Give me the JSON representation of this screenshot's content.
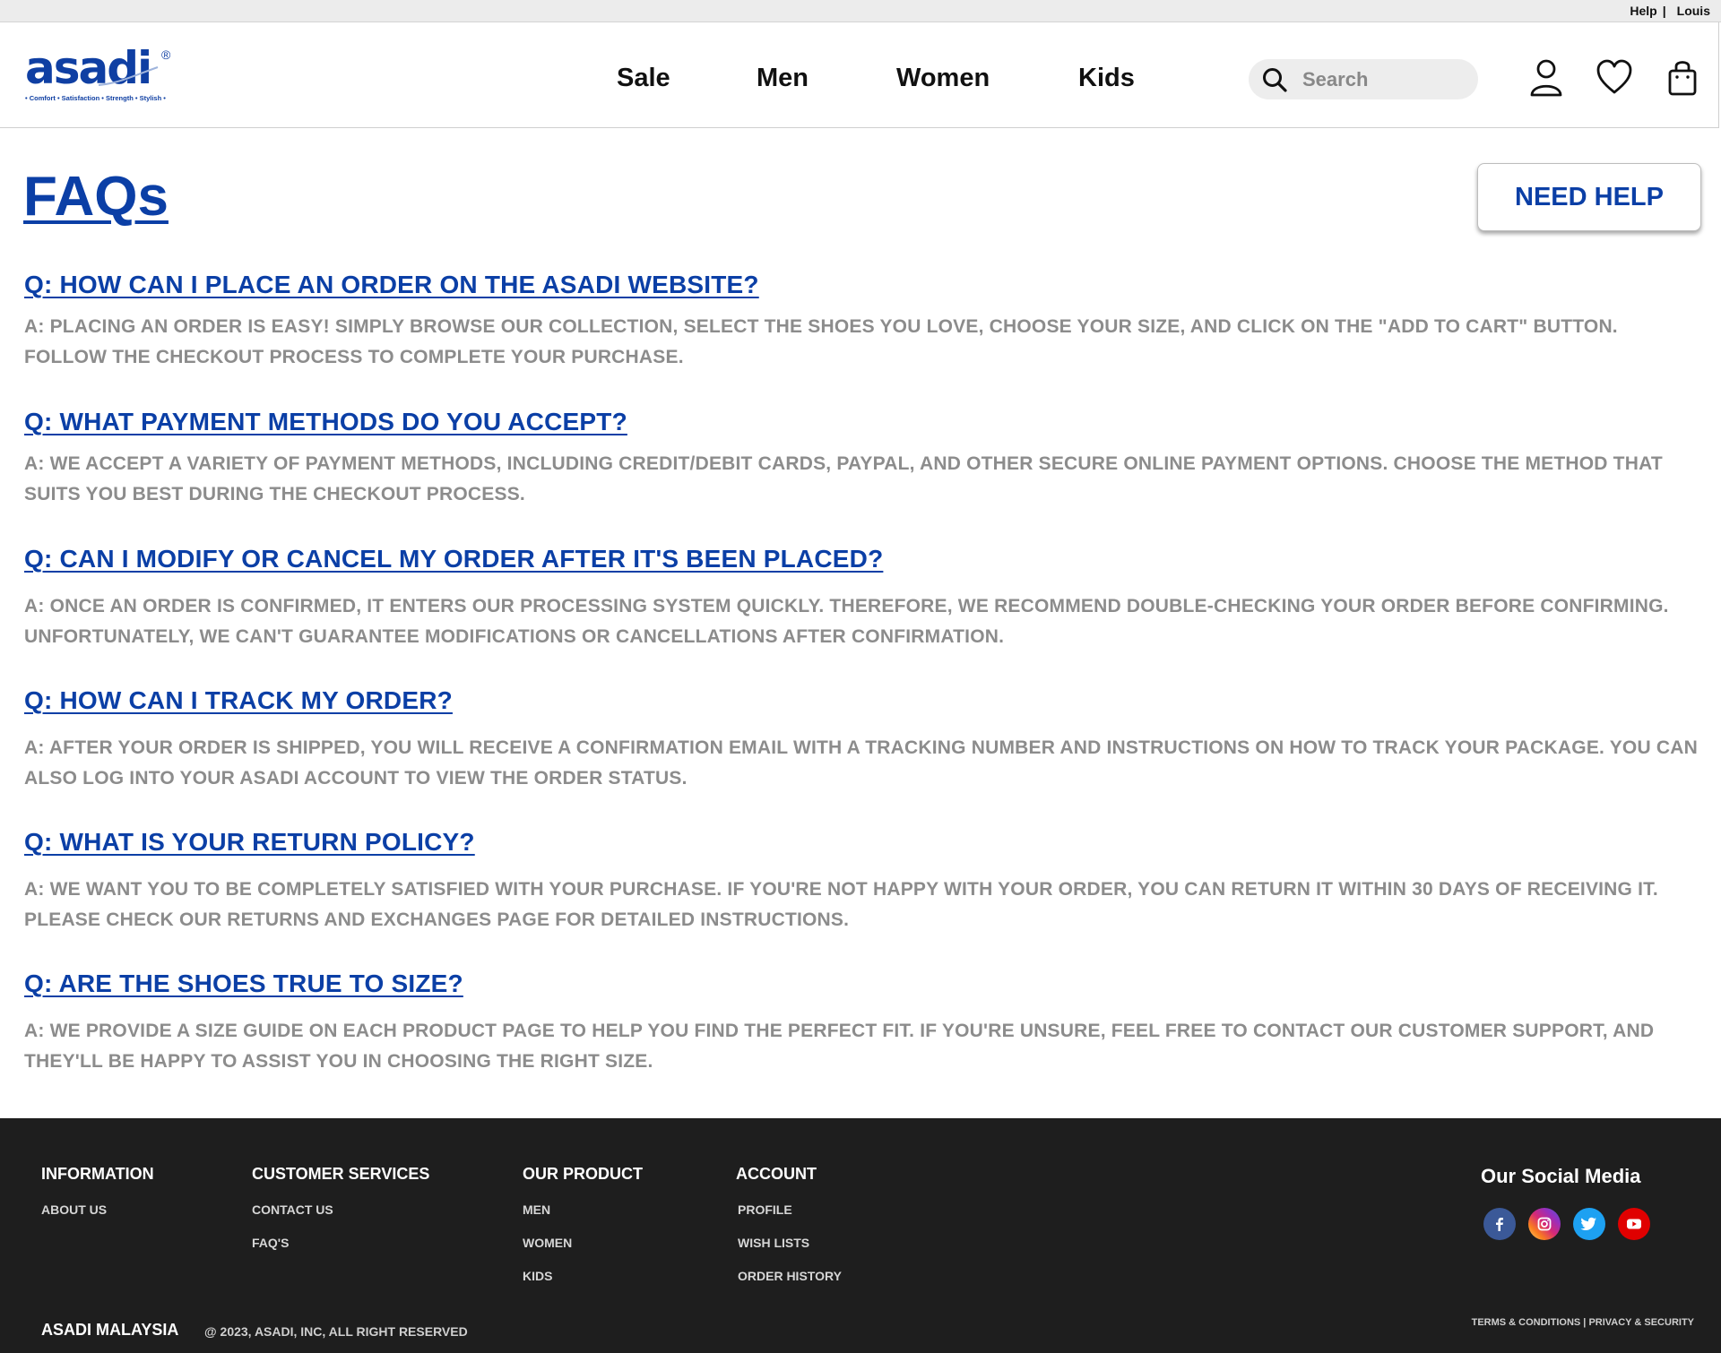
{
  "topbar": {
    "help": "Help",
    "separator": "|",
    "user": "Louis"
  },
  "logo": {
    "wordmark": "asadi",
    "registered": "®",
    "tagline": "• Comfort • Satisfaction • Strength • Stylish •"
  },
  "nav": [
    {
      "label": "Sale"
    },
    {
      "label": "Men"
    },
    {
      "label": "Women"
    },
    {
      "label": "Kids"
    }
  ],
  "search": {
    "placeholder": "Search",
    "icon": "search-icon"
  },
  "header_icons": [
    "user-icon",
    "heart-icon",
    "shopping-bag-icon"
  ],
  "page": {
    "title": "FAQs",
    "need_help": "NEED HELP"
  },
  "faqs": [
    {
      "q": "Q: HOW CAN I PLACE AN ORDER ON THE ASADI WEBSITE?",
      "a": "A: PLACING AN ORDER IS EASY! SIMPLY BROWSE OUR COLLECTION, SELECT THE SHOES YOU LOVE, CHOOSE YOUR SIZE, AND CLICK ON THE \"ADD TO CART\" BUTTON. FOLLOW THE CHECKOUT PROCESS TO COMPLETE YOUR PURCHASE."
    },
    {
      "q": "Q: WHAT PAYMENT METHODS DO YOU ACCEPT?",
      "a": "A: WE ACCEPT A VARIETY OF PAYMENT METHODS, INCLUDING CREDIT/DEBIT CARDS, PAYPAL, AND OTHER SECURE ONLINE PAYMENT OPTIONS. CHOOSE THE METHOD THAT SUITS YOU BEST DURING THE CHECKOUT PROCESS."
    },
    {
      "q": "Q: CAN I MODIFY OR CANCEL MY ORDER AFTER IT'S BEEN PLACED?",
      "a": "A: ONCE AN ORDER IS CONFIRMED, IT ENTERS OUR PROCESSING SYSTEM QUICKLY. THEREFORE, WE RECOMMEND DOUBLE-CHECKING YOUR ORDER BEFORE CONFIRMING. UNFORTUNATELY, WE CAN'T GUARANTEE MODIFICATIONS OR CANCELLATIONS AFTER CONFIRMATION."
    },
    {
      "q": "Q: HOW CAN I TRACK MY ORDER?",
      "a": "A: AFTER YOUR ORDER IS SHIPPED, YOU WILL RECEIVE A CONFIRMATION EMAIL WITH A TRACKING NUMBER AND INSTRUCTIONS ON HOW TO TRACK YOUR PACKAGE. YOU CAN ALSO LOG INTO YOUR ASADI ACCOUNT TO VIEW THE ORDER STATUS."
    },
    {
      "q": "Q: WHAT IS YOUR RETURN POLICY?",
      "a": "A: WE WANT YOU TO BE COMPLETELY SATISFIED WITH YOUR PURCHASE. IF YOU'RE NOT HAPPY WITH YOUR ORDER, YOU CAN RETURN IT WITHIN 30 DAYS OF RECEIVING IT. PLEASE CHECK OUR RETURNS AND EXCHANGES PAGE FOR DETAILED INSTRUCTIONS."
    },
    {
      "q": "Q: ARE THE SHOES TRUE TO SIZE?",
      "a": "A: WE PROVIDE A SIZE GUIDE ON EACH PRODUCT PAGE TO HELP YOU FIND THE PERFECT FIT. IF YOU'RE UNSURE, FEEL FREE TO CONTACT OUR CUSTOMER SUPPORT, AND THEY'LL BE HAPPY TO ASSIST YOU IN CHOOSING THE RIGHT SIZE."
    }
  ],
  "footer": {
    "columns": [
      {
        "title": "INFORMATION",
        "links": [
          "ABOUT US"
        ]
      },
      {
        "title": "CUSTOMER SERVICES",
        "links": [
          "CONTACT US",
          "FAQ'S"
        ]
      },
      {
        "title": "OUR PRODUCT",
        "links": [
          "MEN",
          "WOMEN",
          "KIDS"
        ]
      },
      {
        "title": "ACCOUNT",
        "links": [
          "PROFILE",
          "WISH LISTS",
          "ORDER HISTORY"
        ]
      }
    ],
    "social_title": "Our Social Media",
    "social": [
      {
        "name": "facebook-icon",
        "color": "#3b5998"
      },
      {
        "name": "instagram-icon",
        "color": "#d62976"
      },
      {
        "name": "twitter-icon",
        "color": "#1da1f2"
      },
      {
        "name": "youtube-icon",
        "color": "#e00000"
      }
    ],
    "brand": "ASADI MALAYSIA",
    "copyright": "@ 2023, ASADI, INC, ALL RIGHT RESERVED",
    "terms": "TERMS & CONDITIONS",
    "legal_sep": "|",
    "privacy": "PRIVACY & SECURITY"
  },
  "colors": {
    "brand_blue": "#0b3fa6",
    "answer_gray": "#8c8c8c",
    "footer_bg": "#1e1e1e",
    "search_bg": "#ededed"
  }
}
